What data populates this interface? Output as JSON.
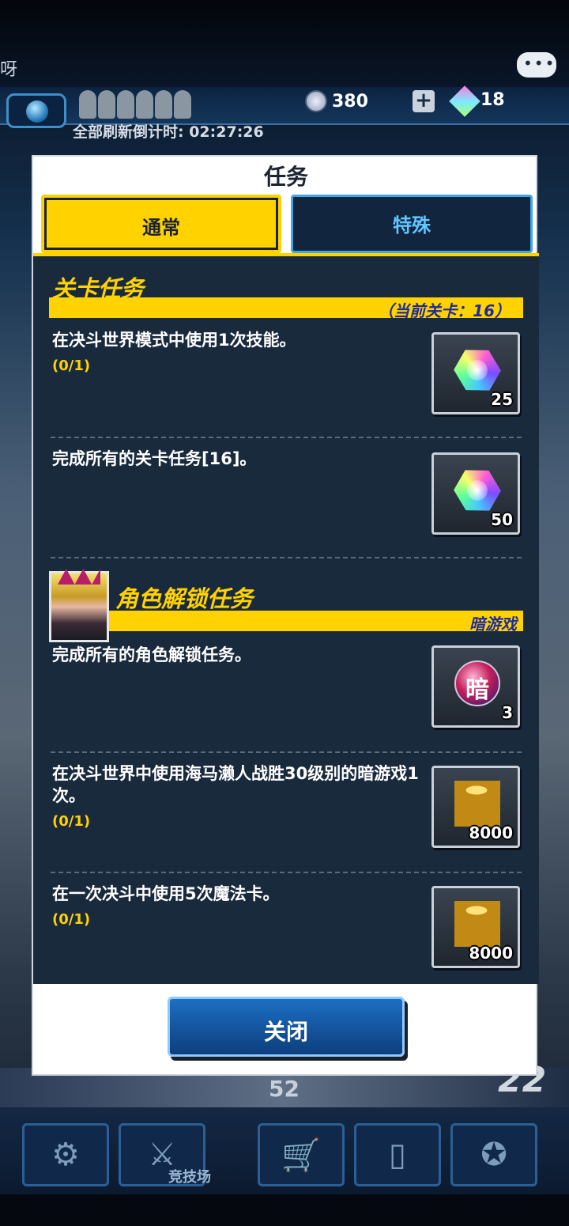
{
  "header": {
    "left_text": "呀",
    "currency_a": "380",
    "currency_b": "18",
    "countdown": "全部刷新倒计时: 02:27:26"
  },
  "modal": {
    "title": "任务",
    "tabs": [
      {
        "label": "通常",
        "selected": true
      },
      {
        "label": "特殊",
        "selected": false
      }
    ],
    "close_label": "关闭",
    "sections": [
      {
        "title": "关卡任务",
        "note": "（当前关卡：16）",
        "tasks": [
          {
            "text": "在决斗世界模式中使用1次技能。",
            "progress": "(0/1)",
            "reward_icon": "gem-icon",
            "reward_qty": "25"
          },
          {
            "text": "完成所有的关卡任务[16]。",
            "progress": "",
            "reward_icon": "gem-icon",
            "reward_qty": "50"
          }
        ]
      },
      {
        "title": "角色解锁任务",
        "note": "暗游戏",
        "tasks": [
          {
            "text": "完成所有的角色解锁任务。",
            "progress": "",
            "reward_icon": "dark-orb-icon",
            "reward_glyph": "暗",
            "reward_qty": "3"
          },
          {
            "text": "在决斗世界中使用海马濑人战胜30级别的暗游戏1次。",
            "progress": "(0/1)",
            "reward_icon": "gold-coins-icon",
            "reward_qty": "8000"
          },
          {
            "text": "在一次决斗中使用5次魔法卡。",
            "progress": "(0/1)",
            "reward_icon": "gold-coins-icon",
            "reward_qty": "8000"
          }
        ]
      }
    ]
  },
  "background": {
    "level_value": "52",
    "rank_value": "22",
    "nav_label": "竞技场"
  },
  "colors": {
    "accent_yellow": "#ffd200",
    "panel_bg": "#1a2a3d",
    "tab_blue": "#3fa7e6",
    "button_blue": "#1d6ec4"
  }
}
